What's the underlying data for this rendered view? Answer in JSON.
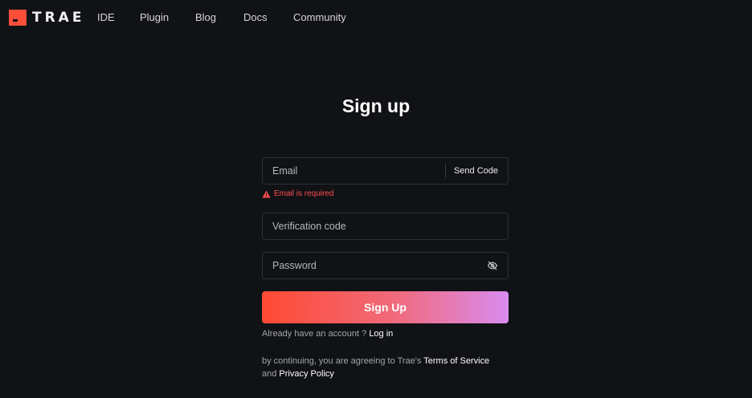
{
  "nav": {
    "logo_text": "TRAE",
    "links": [
      "IDE",
      "Plugin",
      "Blog",
      "Docs",
      "Community"
    ]
  },
  "form": {
    "title": "Sign up",
    "email_placeholder": "Email",
    "send_code_label": "Send Code",
    "error_message": "Email is required",
    "code_placeholder": "Verification code",
    "password_placeholder": "Password",
    "submit_label": "Sign Up",
    "already_text": "Already have an account ? ",
    "login_label": "Log in",
    "terms_prefix": "by continuing, you are agreeing to Trae's ",
    "terms_link": "Terms of Service",
    "terms_and": "and ",
    "privacy_link": "Privacy Policy"
  },
  "colors": {
    "background": "#111216",
    "accent": "#ff4f3a",
    "error": "#ff4d4f",
    "gradient_end": "#d98cf0"
  },
  "icons": {
    "logo": "trae-logo-icon",
    "warning": "warning-icon",
    "password_toggle": "eye-off-icon"
  }
}
